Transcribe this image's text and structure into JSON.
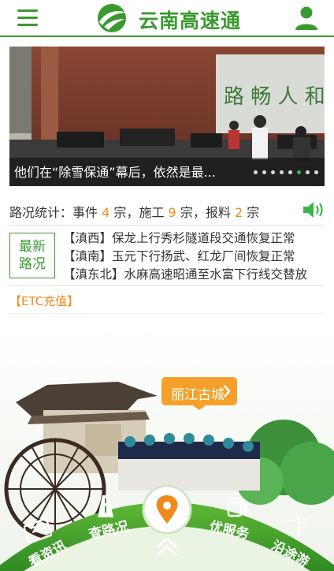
{
  "header": {
    "title": "云南高速通",
    "menu_icon": "hamburger-menu-icon",
    "user_icon": "user-icon",
    "brand_color": "#3a9a2f"
  },
  "banner": {
    "caption": "他们在“除雪保通”幕后，依然是最...",
    "dot_count": 8,
    "active_dot": 5
  },
  "stats": {
    "label": "路况统计：",
    "incident_label": "事件",
    "incident_count": "4",
    "construction_label": "施工",
    "construction_count": "9",
    "report_label": "报料",
    "report_count": "2",
    "unit": "宗",
    "highlight_color": "#f08a1c"
  },
  "news": {
    "badge_line1": "最新",
    "badge_line2": "路况",
    "items": [
      "【滇西】保龙上行秀杉隧道段交通恢复正常",
      "【滇南】玉元下行扬武、红龙厂间恢复正常",
      "【滇东北】水麻高速昭通至水富下行线交替放"
    ]
  },
  "etc": {
    "label": "【ETC充值】"
  },
  "scene": {
    "tag_label": "丽江古城",
    "nav": {
      "news": "看资讯",
      "road": "查路况",
      "service": "优服务",
      "travel": "沿途游"
    }
  }
}
